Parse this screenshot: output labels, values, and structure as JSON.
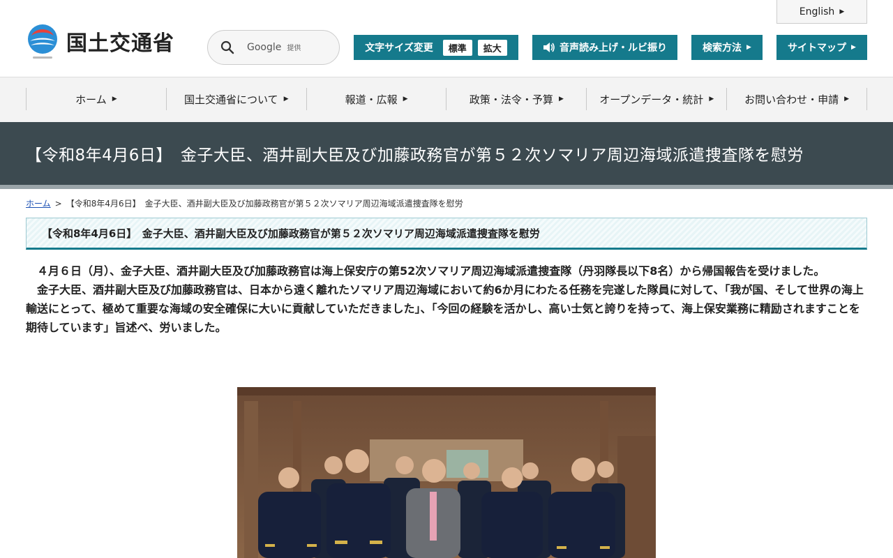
{
  "header": {
    "logo_text": "国土交通省",
    "search_label": "Google",
    "search_sub": "提供",
    "english_label": "English",
    "font_size_label": "文字サイズ変更",
    "font_size_standard": "標準",
    "font_size_large": "拡大",
    "speech_label": "音声読み上げ・ルビ振り",
    "search_method_label": "検索方法",
    "sitemap_label": "サイトマップ"
  },
  "nav": {
    "items": [
      "ホーム",
      "国土交通省について",
      "報道・広報",
      "政策・法令・予算",
      "オープンデータ・統計",
      "お問い合わせ・申請"
    ]
  },
  "page": {
    "title": "【令和8年4月6日】　金子大臣、酒井副大臣及び加藤政務官が第５２次ソマリア周辺海域派遣捜査隊を慰労",
    "breadcrumb_home": "ホーム",
    "breadcrumb_sep": ">",
    "breadcrumb_current": "【令和8年4月6日】　金子大臣、酒井副大臣及び加藤政務官が第５２次ソマリア周辺海域派遣捜査隊を慰労",
    "subtitle": "【令和8年4月6日】　金子大臣、酒井副大臣及び加藤政務官が第５２次ソマリア周辺海域派遣捜査隊を慰労",
    "paragraph1": "４月６日（月）、金子大臣、酒井副大臣及び加藤政務官は海上保安庁の第52次ソマリア周辺海域派遣捜査隊（丹羽隊長以下8名）から帰国報告を受けました。",
    "paragraph2": "金子大臣、酒井副大臣及び加藤政務官は、日本から遠く離れたソマリア周辺海域において約6か月にわたる任務を完遂した隊員に対して、「我が国、そして世界の海上輸送にとって、極めて重要な海域の安全確保に大いに貢献していただきました」、「今回の経験を活かし、高い士気と誇りを持って、海上保安業務に精励されますことを期待しています」旨述べ、労いました。"
  },
  "colors": {
    "accent": "#157a8c",
    "title_band": "#3c4a50",
    "link": "#1a4fb3"
  }
}
